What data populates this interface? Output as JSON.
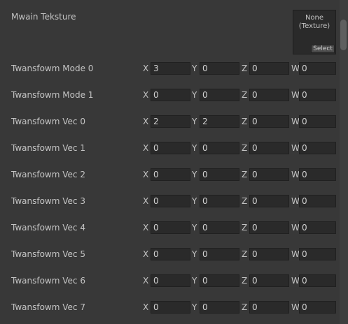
{
  "main_texture": {
    "label": "Mwain Teksture",
    "value_line1": "None",
    "value_line2": "(Texture)",
    "select_label": "Select"
  },
  "axis_labels": {
    "x": "X",
    "y": "Y",
    "z": "Z",
    "w": "W"
  },
  "rows": [
    {
      "label": "Twansfowm Mode 0",
      "x": "3",
      "y": "0",
      "z": "0",
      "w": "0"
    },
    {
      "label": "Twansfowm Mode 1",
      "x": "0",
      "y": "0",
      "z": "0",
      "w": "0"
    },
    {
      "label": "Twansfowm Vec 0",
      "x": "2",
      "y": "2",
      "z": "0",
      "w": "0"
    },
    {
      "label": "Twansfowm Vec 1",
      "x": "0",
      "y": "0",
      "z": "0",
      "w": "0"
    },
    {
      "label": "Twansfowm Vec 2",
      "x": "0",
      "y": "0",
      "z": "0",
      "w": "0"
    },
    {
      "label": "Twansfowm Vec 3",
      "x": "0",
      "y": "0",
      "z": "0",
      "w": "0"
    },
    {
      "label": "Twansfowm Vec 4",
      "x": "0",
      "y": "0",
      "z": "0",
      "w": "0"
    },
    {
      "label": "Twansfowm Vec 5",
      "x": "0",
      "y": "0",
      "z": "0",
      "w": "0"
    },
    {
      "label": "Twansfowm Vec 6",
      "x": "0",
      "y": "0",
      "z": "0",
      "w": "0"
    },
    {
      "label": "Twansfowm Vec 7",
      "x": "0",
      "y": "0",
      "z": "0",
      "w": "0"
    }
  ]
}
